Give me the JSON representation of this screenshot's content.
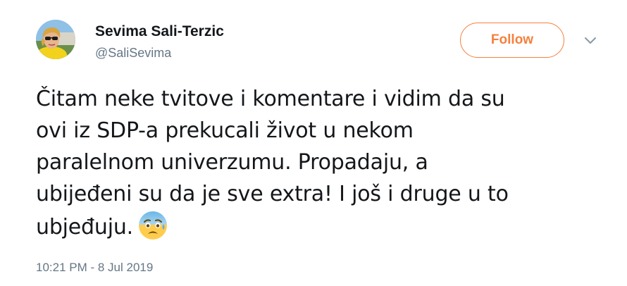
{
  "author": {
    "name": "Sevima Sali-Terzic",
    "handle": "@SaliSevima"
  },
  "follow_label": "Follow",
  "tweet": {
    "lines": [
      "Čitam neke tvitove i komentare i vidim da su",
      "ovi iz SDP-a prekucali život u nekom",
      "paralelnom univerzumu. Propadaju, a",
      "ubijeđeni su da je sve extra! I još i druge u to",
      "ubjeđuju."
    ],
    "emoji": "anxious-face-with-sweat"
  },
  "timestamp": "10:21 PM - 8 Jul 2019",
  "colors": {
    "accent": "#f5803e",
    "text": "#14171a",
    "secondary_text": "#657786"
  }
}
